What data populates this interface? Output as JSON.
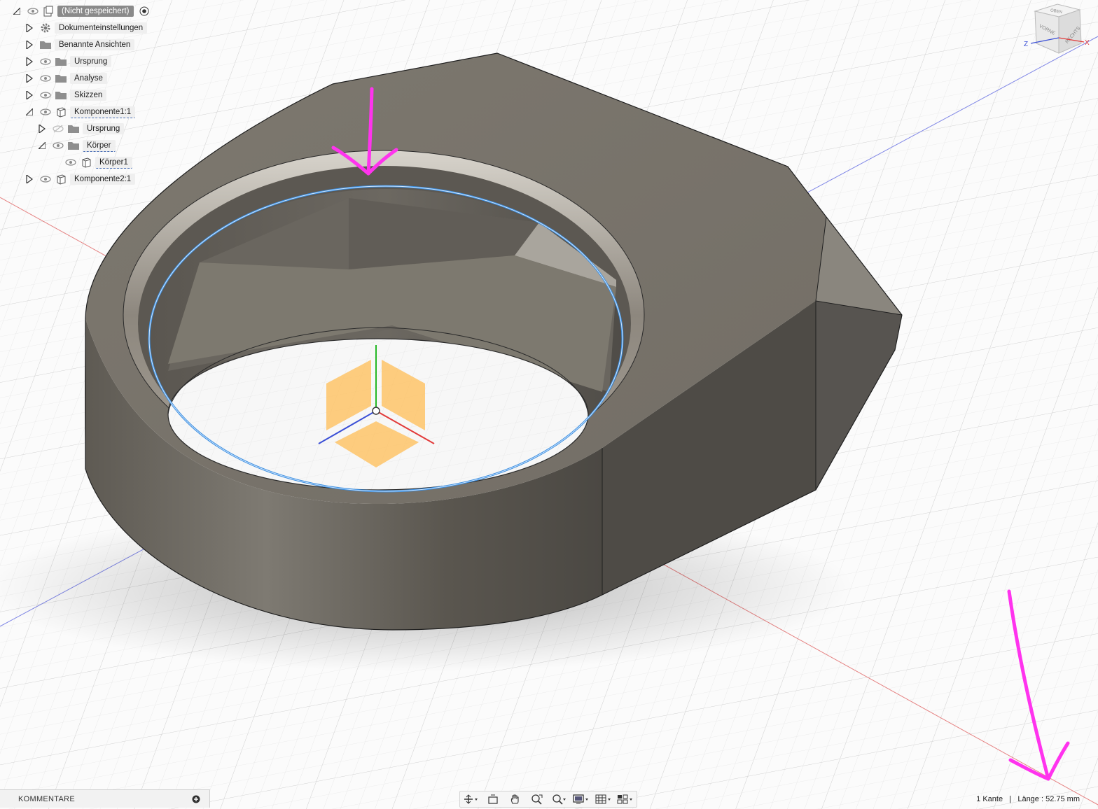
{
  "browser": {
    "root": {
      "label": "(Nicht gespeichert)"
    },
    "items": [
      {
        "label": "Dokumenteinstellungen"
      },
      {
        "label": "Benannte Ansichten"
      },
      {
        "label": "Ursprung"
      },
      {
        "label": "Analyse"
      },
      {
        "label": "Skizzen"
      },
      {
        "label": "Komponente1:1"
      },
      {
        "label": "Ursprung"
      },
      {
        "label": "Körper"
      },
      {
        "label": "Körper1"
      },
      {
        "label": "Komponente2:1"
      }
    ]
  },
  "viewcube": {
    "top": "OBEN",
    "front": "VORNE",
    "right": "RECHTS",
    "axis_x": "X",
    "axis_z": "Z"
  },
  "comments": {
    "label": "KOMMENTARE"
  },
  "status": {
    "selection": "1 Kante",
    "separator": "|",
    "length_label": "Länge : 52.75 mm"
  },
  "colors": {
    "annotation": "#ff33ee",
    "selected_edge": "#3d8fe0",
    "body": "#6f6a62",
    "axis_red": "#e23a3a",
    "axis_blue": "#3a4fd6",
    "axis_green": "#25b825",
    "origin_plane": "#ffb84d"
  }
}
